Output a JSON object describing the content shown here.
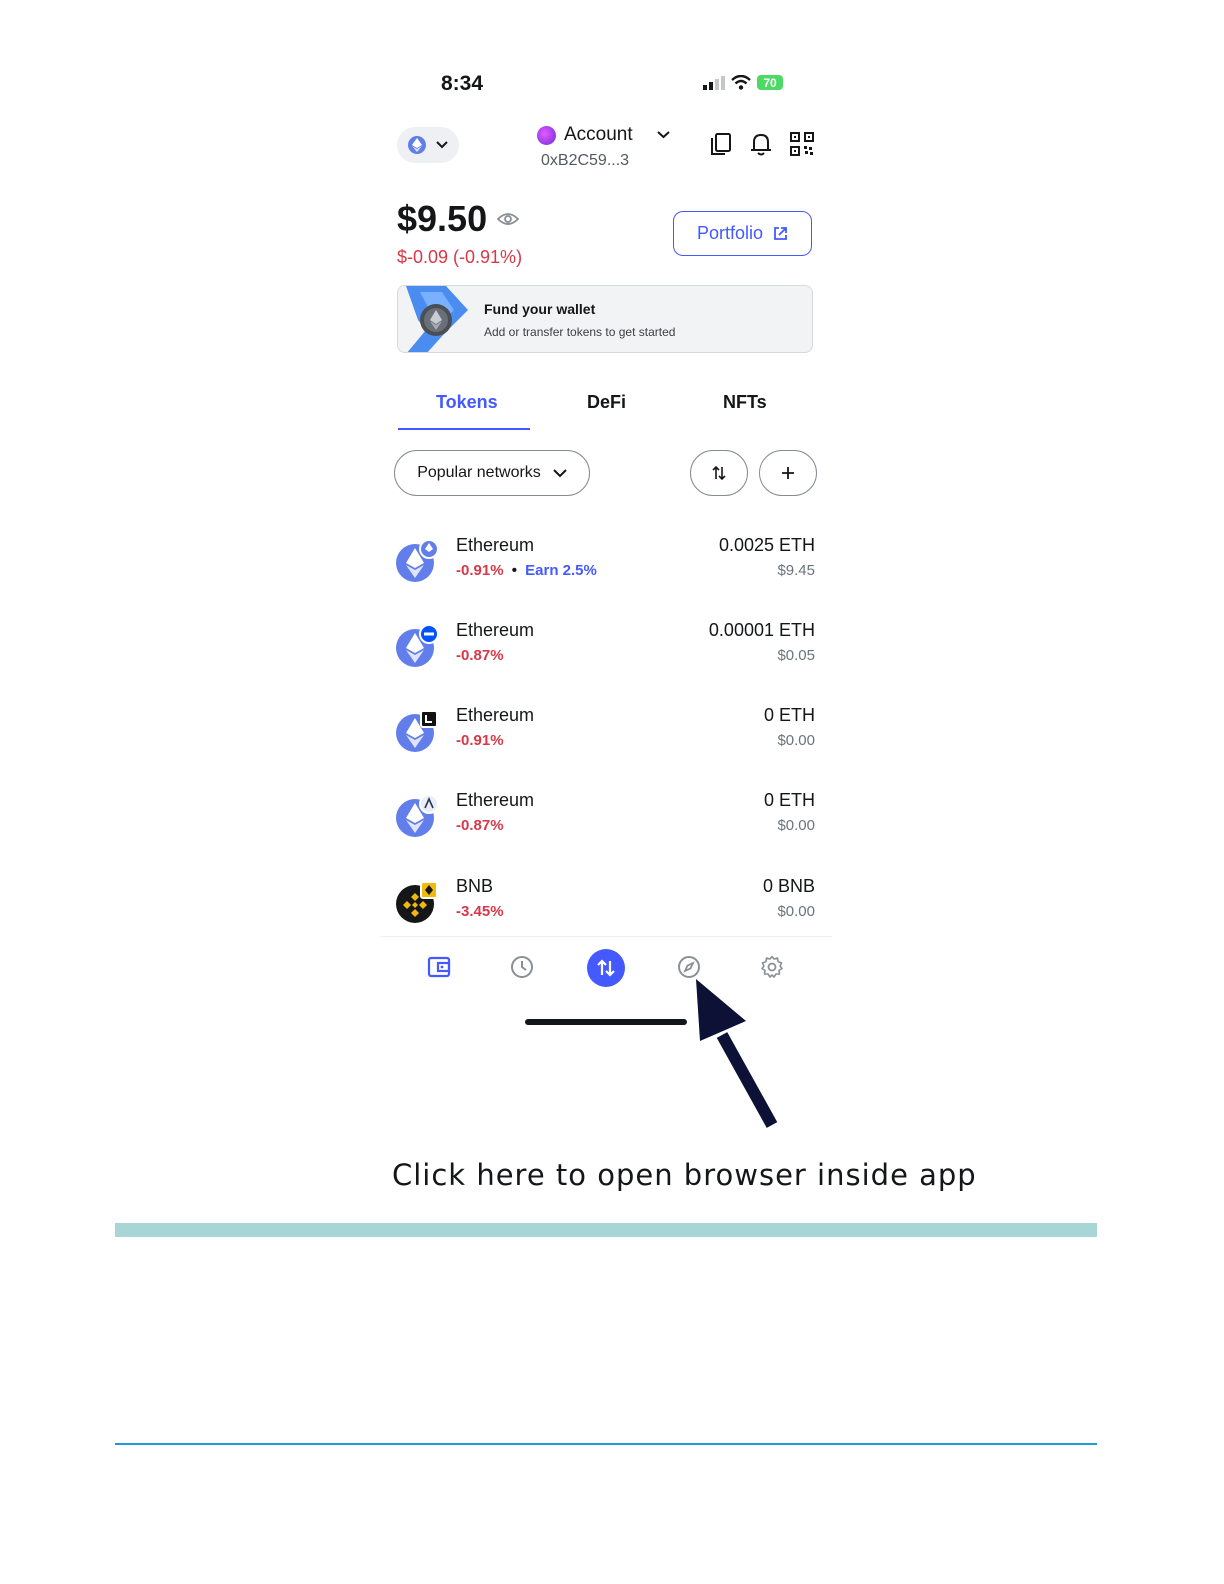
{
  "status_bar": {
    "time": "8:34",
    "battery": "70"
  },
  "header": {
    "account_name": "Account",
    "address": "0xB2C59...3"
  },
  "balance": {
    "amount": "$9.50",
    "change": "$-0.09 (-0.91%)",
    "portfolio_label": "Portfolio"
  },
  "fund_card": {
    "title": "Fund your wallet",
    "subtitle": "Add or transfer tokens to get started"
  },
  "tabs": [
    {
      "label": "Tokens"
    },
    {
      "label": "DeFi"
    },
    {
      "label": "NFTs"
    }
  ],
  "filter": {
    "label": "Popular networks"
  },
  "tokens": [
    {
      "name": "Ethereum",
      "change": "-0.91%",
      "earn": "Earn 2.5%",
      "amount": "0.0025 ETH",
      "fiat": "$9.45"
    },
    {
      "name": "Ethereum",
      "change": "-0.87%",
      "amount": "0.00001 ETH",
      "fiat": "$0.05"
    },
    {
      "name": "Ethereum",
      "change": "-0.91%",
      "amount": "0 ETH",
      "fiat": "$0.00"
    },
    {
      "name": "Ethereum",
      "change": "-0.87%",
      "amount": "0 ETH",
      "fiat": "$0.00"
    },
    {
      "name": "BNB",
      "change": "-3.45%",
      "amount": "0 BNB",
      "fiat": "$0.00"
    }
  ],
  "nav_icons": [
    "wallet-icon",
    "clock-icon",
    "swap-icon",
    "compass-icon",
    "gear-icon"
  ],
  "caption": "Click here to open browser inside app",
  "colors": {
    "accent": "#4459ff",
    "negative": "#d73847",
    "eth": "#627eea",
    "teal_bar": "#a8d5d6",
    "blue_line": "#1d9bd7"
  }
}
